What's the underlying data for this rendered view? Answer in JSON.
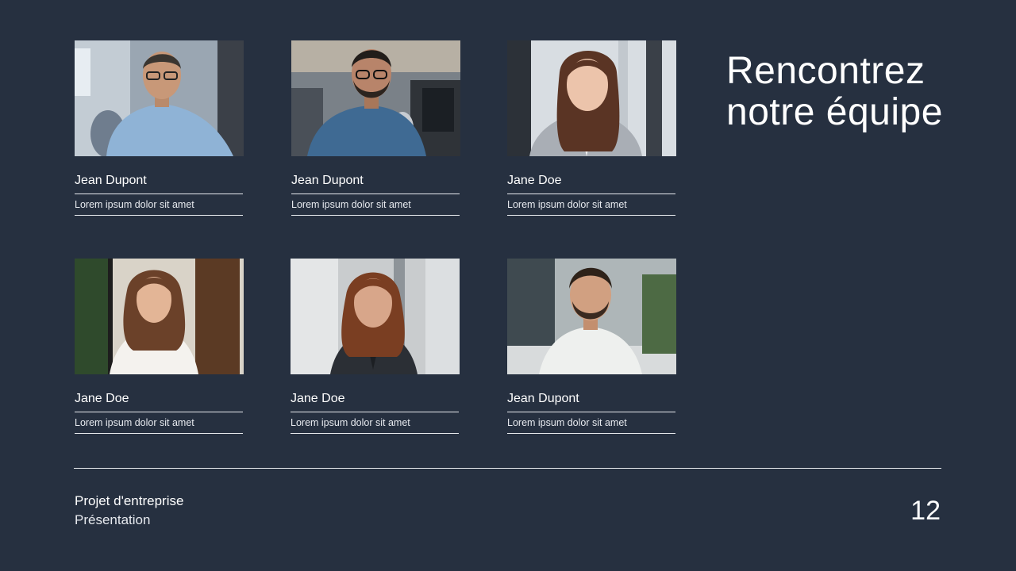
{
  "slide": {
    "title_line1": "Rencontrez",
    "title_line2": "notre équipe",
    "page_number": "12"
  },
  "team": [
    {
      "name": "Jean Dupont",
      "role": "Lorem ipsum dolor sit amet",
      "photo": "man-glasses-office-photo"
    },
    {
      "name": "Jean Dupont",
      "role": "Lorem ipsum dolor sit amet",
      "photo": "man-beard-glasses-office-photo"
    },
    {
      "name": "Jane Doe",
      "role": "Lorem ipsum dolor sit amet",
      "photo": "woman-long-hair-office-photo"
    },
    {
      "name": "Jane Doe",
      "role": "Lorem ipsum dolor sit amet",
      "photo": "woman-white-blouse-photo"
    },
    {
      "name": "Jane Doe",
      "role": "Lorem ipsum dolor sit amet",
      "photo": "woman-dark-blazer-photo"
    },
    {
      "name": "Jean Dupont",
      "role": "Lorem ipsum dolor sit amet",
      "photo": "man-smiling-white-shirt-photo"
    }
  ],
  "footer": {
    "company": "Projet d'entreprise",
    "subtitle": "Présentation"
  },
  "colors": {
    "background": "#263040",
    "text": "#ffffff",
    "rule": "#e8ebef"
  }
}
